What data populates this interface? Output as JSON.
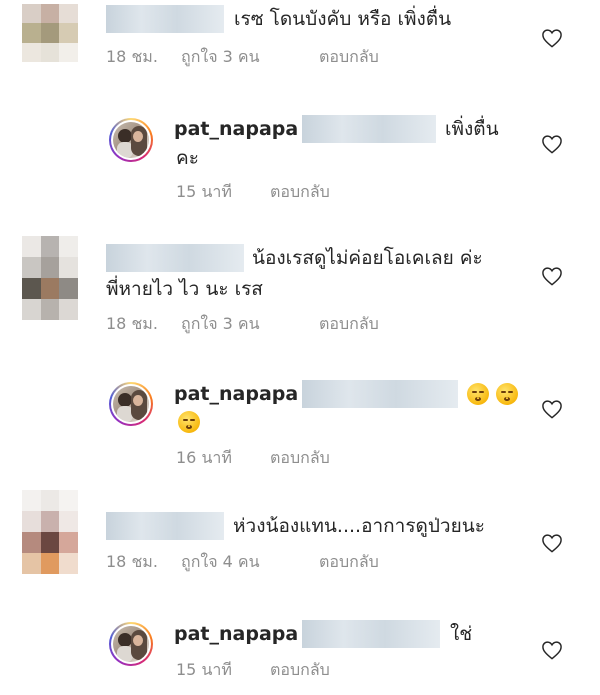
{
  "comments": [
    {
      "text_line1": "เรซ โดนบังคับ หรือ เพิ่งตื่น",
      "time": "18 ชม.",
      "likes": "ถูกใจ 3 คน",
      "reply": "ตอบกลับ"
    },
    {
      "username": "pat_napapa",
      "text_line1": "เพิ่งตื่น",
      "text_line2": "คะ",
      "time": "15 นาที",
      "reply": "ตอบกลับ"
    },
    {
      "text_line1": "น้องเรสดูไม่ค่อยโอเคเลย ค่ะ",
      "text_line2": "พี่หายไว ไว นะ เรส",
      "time": "18 ชม.",
      "likes": "ถูกใจ 3 คน",
      "reply": "ตอบกลับ"
    },
    {
      "username": "pat_napapa",
      "time": "16 นาที",
      "reply": "ตอบกลับ"
    },
    {
      "text_line1": "ห่วงน้องแทน....อาการดูป่วยนะ",
      "time": "18 ชม.",
      "likes": "ถูกใจ 4 คน",
      "reply": "ตอบกลับ"
    },
    {
      "username": "pat_napapa",
      "text_line1": "ใช่",
      "time": "15 นาที",
      "reply": "ตอบกลับ"
    }
  ],
  "icons": {
    "like": "heart-outline-icon",
    "emoji": "relieved-face-emoji"
  },
  "colors": {
    "text": "#262626",
    "meta": "#8e8e8e",
    "background": "#ffffff"
  }
}
